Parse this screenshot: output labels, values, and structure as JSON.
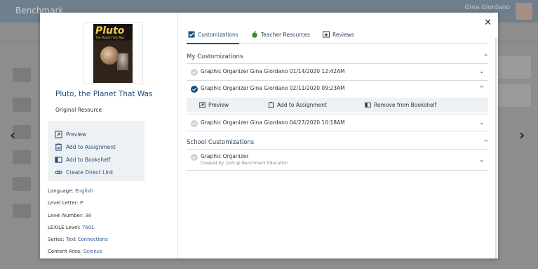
{
  "background": {
    "logo": "Benchmark",
    "user_name": "Gina Giordano",
    "nav_left_arrow": "‹",
    "nav_right_arrow": "›"
  },
  "resource": {
    "cover_title": "Pluto",
    "cover_subtitle": "The Planet That Was",
    "title": "Pluto, the Planet That Was",
    "subtitle": "Original Resource"
  },
  "actions": [
    {
      "label": "Preview",
      "icon": "preview-icon"
    },
    {
      "label": "Add to Assignment",
      "icon": "assignment-icon"
    },
    {
      "label": "Add to Bookshelf",
      "icon": "bookshelf-icon"
    },
    {
      "label": "Create Direct Link",
      "icon": "link-icon"
    }
  ],
  "meta": [
    {
      "key": "Language:",
      "value": "English"
    },
    {
      "key": "Level Letter:",
      "value": "P"
    },
    {
      "key": "Level Number:",
      "value": "38"
    },
    {
      "key": "LEXILE Level:",
      "value": "760L"
    },
    {
      "key": "Series:",
      "value": "Text Connections"
    },
    {
      "key": "Content Area:",
      "value": "Science"
    }
  ],
  "tabs": [
    {
      "label": "Customizations",
      "active": true
    },
    {
      "label": "Teacher Resources",
      "active": false
    },
    {
      "label": "Reviews",
      "active": false
    }
  ],
  "my_customizations": {
    "heading": "My Customizations",
    "items": [
      {
        "label": "Graphic Organizer Gina Giordano 01/14/2020 12:42AM",
        "checked": false
      },
      {
        "label": "Graphic Organizer Gina Giordano 02/11/2020 09:23AM",
        "checked": true
      },
      {
        "label": "Graphic Organizer Gina Giordano 04/27/2020 10:18AM",
        "checked": false
      }
    ],
    "expanded_actions": [
      {
        "label": "Preview",
        "icon": "preview-icon"
      },
      {
        "label": "Add to Assignment",
        "icon": "assignment-icon"
      },
      {
        "label": "Remove from Bookshelf",
        "icon": "bookshelf-icon"
      }
    ]
  },
  "school_customizations": {
    "heading": "School Customizations",
    "items": [
      {
        "label": "Graphic Organizer",
        "sub": "Created by: Josh @ Benchmark Education"
      }
    ]
  },
  "colors": {
    "accent": "#1f4e79",
    "panel": "#eef1f4"
  }
}
